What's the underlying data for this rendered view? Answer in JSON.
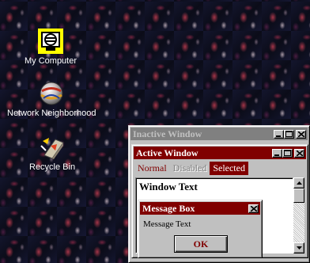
{
  "desktop": {
    "icons": [
      {
        "label": "My Computer"
      },
      {
        "label": "Network Neighborhood"
      },
      {
        "label": "Recycle Bin"
      }
    ]
  },
  "inactive_window": {
    "title": "Inactive Window"
  },
  "active_window": {
    "title": "Active Window",
    "menu": {
      "normal": "Normal",
      "disabled": "Disabled",
      "selected": "Selected"
    },
    "window_text": "Window Text"
  },
  "message_box": {
    "title": "Message Box",
    "text": "Message Text",
    "ok_label": "OK"
  },
  "colors": {
    "active_title": "#800000",
    "inactive_title": "#808080",
    "face": "#c0c0c0",
    "desktop": "#0a0c1c"
  },
  "icon_names": [
    "computer-icon",
    "network-icon",
    "recycle-bin-icon",
    "minimize-icon",
    "maximize-icon",
    "close-icon"
  ]
}
